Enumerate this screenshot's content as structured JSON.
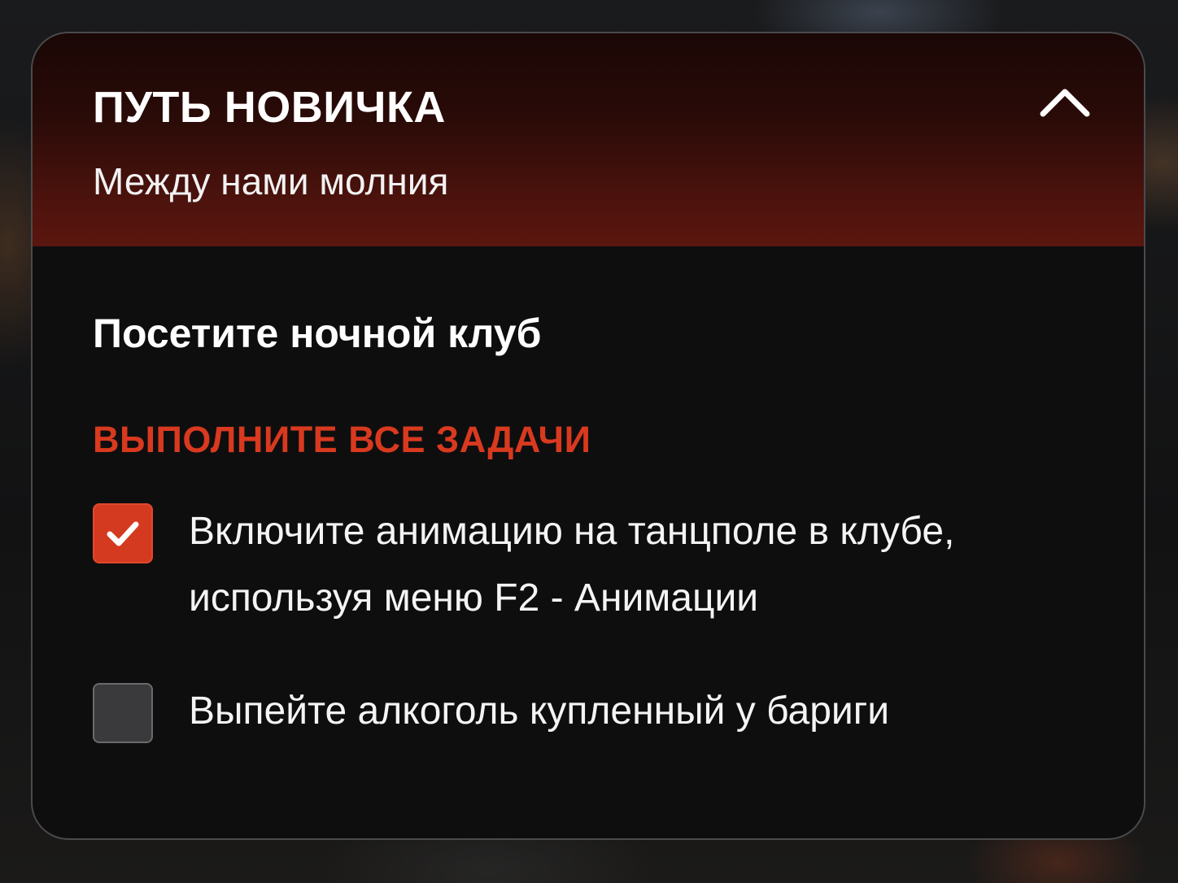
{
  "header": {
    "title": "ПУТЬ НОВИЧКА",
    "subtitle": "Между нами молния",
    "collapse_icon": "chevron-up-icon"
  },
  "quest": {
    "title": "Посетите ночной клуб",
    "section_label": "ВЫПОЛНИТЕ ВСЕ ЗАДАЧИ",
    "tasks": [
      {
        "text": "Включите анимацию на танцполе в клубе, используя меню F2 - Анимации",
        "completed": true
      },
      {
        "text": "Выпейте алкоголь купленный у бариги",
        "completed": false
      }
    ]
  },
  "colors": {
    "accent": "#d43a1f",
    "header_gradient_top": "#1a0706",
    "header_gradient_bottom": "#5a160f",
    "panel_background": "#0e0e0f"
  }
}
